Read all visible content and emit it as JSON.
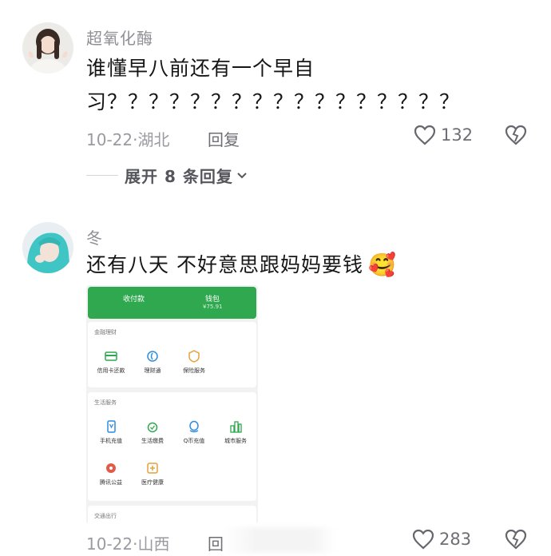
{
  "comments": [
    {
      "username": "超氧化酶",
      "text_line1": "谁懂早八前还有一个早自",
      "text_line2": "习？？？？？？？？？？？？？？？？？",
      "date": "10-22·湖北",
      "reply_label": "回复",
      "likes": "132",
      "expand_label": "展开 8 条回复"
    },
    {
      "username": "冬",
      "text": "还有八天 不好意思跟妈妈要钱",
      "emoji": "🥰",
      "date": "10-22·山西",
      "reply_label": "回",
      "likes": "283"
    }
  ],
  "wallet": {
    "header": {
      "pay_label": "收付款",
      "wallet_label": "钱包",
      "balance": "¥75.91"
    },
    "sections": [
      {
        "title": "金融理财",
        "items": [
          {
            "label": "信用卡还款",
            "icon": "credit-card-icon"
          },
          {
            "label": "理财通",
            "icon": "wealth-icon"
          },
          {
            "label": "保险服务",
            "icon": "insurance-icon"
          }
        ]
      },
      {
        "title": "生活服务",
        "items": [
          {
            "label": "手机充值",
            "icon": "phone-topup-icon"
          },
          {
            "label": "生活缴费",
            "icon": "utility-bill-icon"
          },
          {
            "label": "Q币充值",
            "icon": "qcoin-icon"
          },
          {
            "label": "城市服务",
            "icon": "city-service-icon"
          },
          {
            "label": "腾讯公益",
            "icon": "charity-icon"
          },
          {
            "label": "医疗健康",
            "icon": "medical-icon"
          }
        ]
      },
      {
        "title": "交通出行",
        "items": []
      }
    ]
  },
  "colors": {
    "wallet_green": "#2fa84f",
    "text_gray": "#9a9aa0"
  }
}
